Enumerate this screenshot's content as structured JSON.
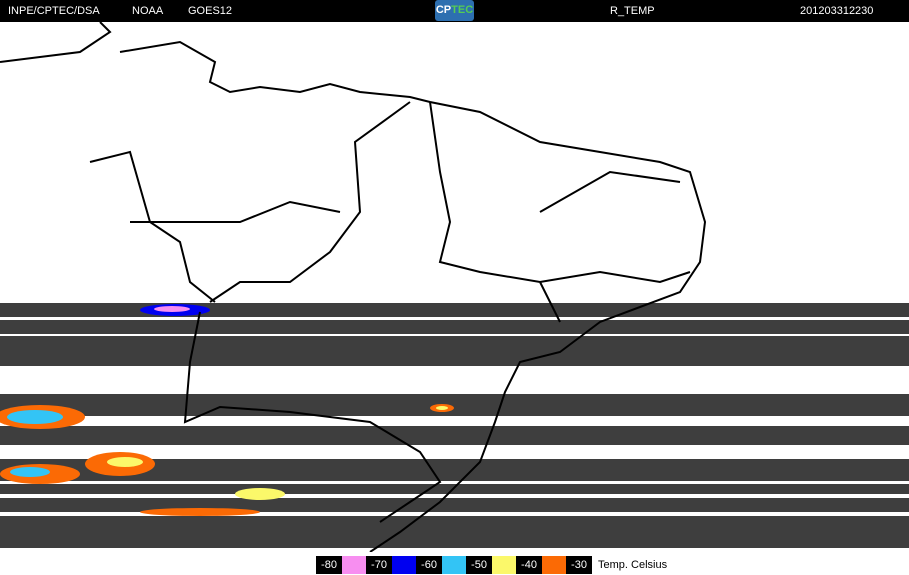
{
  "header": {
    "source": "INPE/CPTEC/DSA",
    "agency": "NOAA",
    "satellite": "GOES12",
    "logo": "CPTEC",
    "product": "R_TEMP",
    "datetime": "201203312230"
  },
  "legend": {
    "unit_label": "Temp. Celsius",
    "items": [
      {
        "label": "-80",
        "color": "#f78ef0"
      },
      {
        "label": "-70",
        "color": "#0000f0"
      },
      {
        "label": "-60",
        "color": "#33c4f5"
      },
      {
        "label": "-50",
        "color": "#fbf86a"
      },
      {
        "label": "-40",
        "color": "#fb6a05"
      },
      {
        "label": "-30",
        "color": null
      }
    ]
  }
}
